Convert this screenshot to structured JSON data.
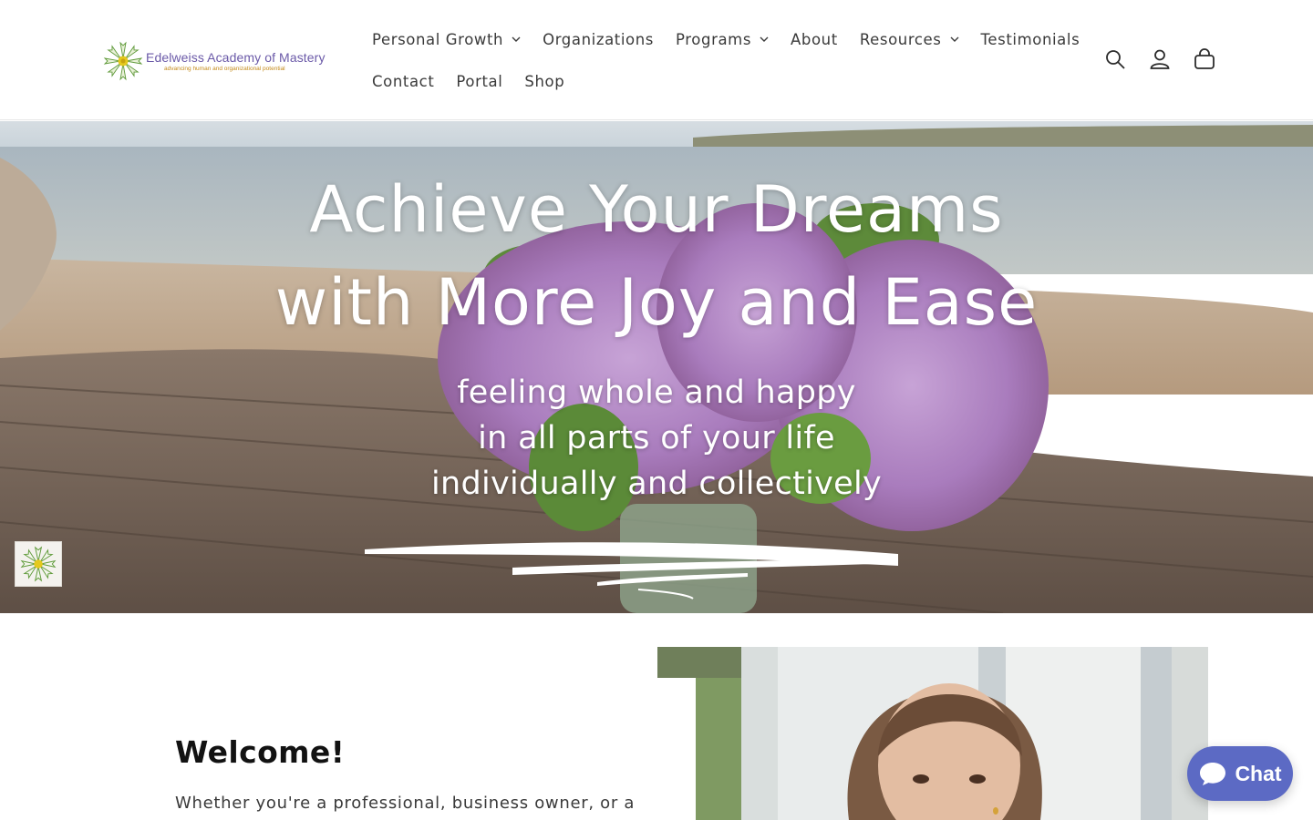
{
  "brand": {
    "name": "Edelweiss Academy of Mastery",
    "tagline": "advancing human and organizational potential",
    "colors": {
      "name": "#6b5aa8",
      "tagline": "#c48a1a",
      "chat": "#5c6ac4"
    }
  },
  "nav": {
    "row1": [
      {
        "label": "Personal Growth",
        "dropdown": true
      },
      {
        "label": "Organizations",
        "dropdown": false
      },
      {
        "label": "Programs",
        "dropdown": true
      },
      {
        "label": "About",
        "dropdown": false
      },
      {
        "label": "Resources",
        "dropdown": true
      },
      {
        "label": "Testimonials",
        "dropdown": false
      }
    ],
    "row2": [
      {
        "label": "Contact",
        "dropdown": false
      },
      {
        "label": "Portal",
        "dropdown": false
      },
      {
        "label": "Shop",
        "dropdown": false
      }
    ]
  },
  "header_icons": [
    "search-icon",
    "account-icon",
    "cart-icon"
  ],
  "hero": {
    "title_line1": "Achieve Your Dreams",
    "title_line2": "with More Joy and Ease",
    "sub_line1": "feeling whole and happy",
    "sub_line2": "in all parts of your life",
    "sub_line3": "individually and collectively"
  },
  "welcome": {
    "title": "Welcome!",
    "text": "Whether you're a professional, business owner, or a"
  },
  "chat": {
    "label": "Chat"
  }
}
